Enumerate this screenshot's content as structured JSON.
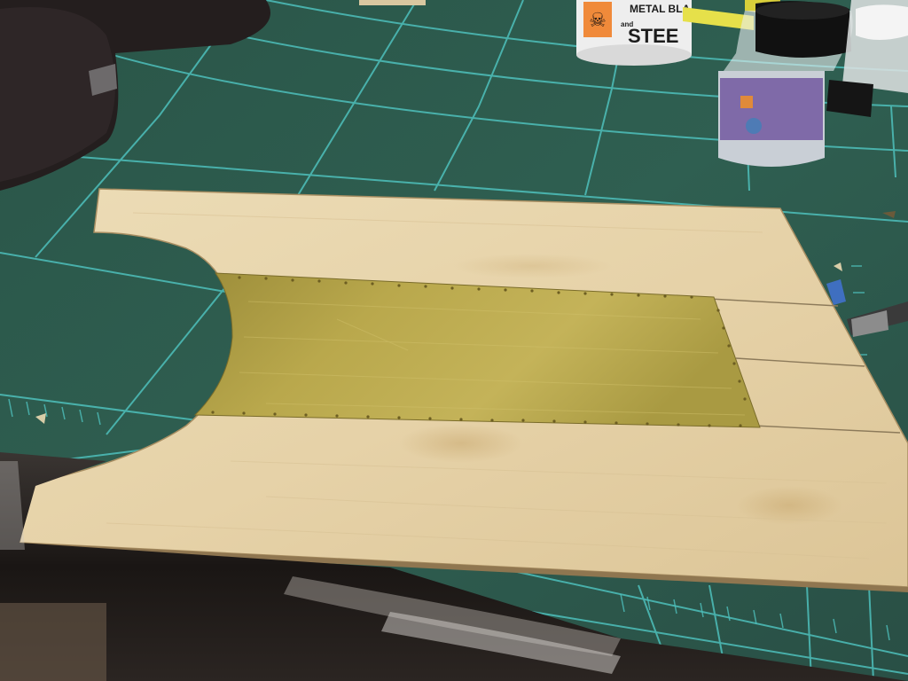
{
  "photo": {
    "bottle_label_line1": "METAL BLA",
    "bottle_label_line2": "STEE",
    "bottle_label_prefix": "and"
  },
  "colors": {
    "cutting_mat": "#2f5e50",
    "grid_lines": "#4fc3c0",
    "plywood": "#e7d5ae",
    "brass": "#b8a647"
  }
}
